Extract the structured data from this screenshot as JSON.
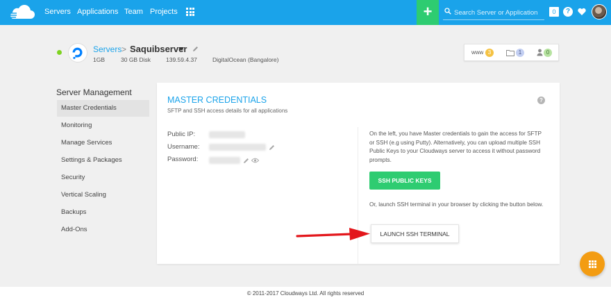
{
  "nav": {
    "items": [
      {
        "label": "Servers"
      },
      {
        "label": "Applications"
      },
      {
        "label": "Team"
      },
      {
        "label": "Projects"
      }
    ],
    "add_label": "+",
    "search_placeholder": "Search Server or Application",
    "notification_count": "0",
    "help_label": "?"
  },
  "server": {
    "breadcrumb_root": "Servers",
    "breadcrumb_sep": ">",
    "name": "Saquibserver",
    "ram": "1GB",
    "disk": "30 GB Disk",
    "ip": "139.59.4.37",
    "provider": "DigitalOcean (Bangalore)",
    "status_color": "#7ed321"
  },
  "stats": {
    "www_label": "www",
    "www_count": "3",
    "folders_count": "1",
    "users_count": "0"
  },
  "sidebar": {
    "title": "Server Management",
    "items": [
      {
        "label": "Master Credentials",
        "active": true
      },
      {
        "label": "Monitoring"
      },
      {
        "label": "Manage Services"
      },
      {
        "label": "Settings & Packages"
      },
      {
        "label": "Security"
      },
      {
        "label": "Vertical Scaling"
      },
      {
        "label": "Backups"
      },
      {
        "label": "Add-Ons"
      }
    ]
  },
  "panel": {
    "title": "MASTER CREDENTIALS",
    "subtitle": "SFTP and SSH access details for all applications",
    "help_label": "?",
    "fields": [
      {
        "label": "Public IP:"
      },
      {
        "label": "Username:"
      },
      {
        "label": "Password:"
      }
    ],
    "info_text": "On the left, you have Master credentials to gain the access for SFTP or SSH (e.g using Putty). Alternatively, you can upload multiple SSH Public Keys to your Cloudways server to access it without password prompts.",
    "ssh_keys_button": "SSH PUBLIC KEYS",
    "launch_text": "Or, launch SSH terminal in your browser by clicking the button below.",
    "launch_button": "LAUNCH SSH TERMINAL"
  },
  "footer": {
    "copyright": "© 2011-2017 Cloudways Ltd. All rights reserved"
  },
  "colors": {
    "brand_blue": "#1aa3ea",
    "green": "#2ecc71",
    "orange": "#f39c12",
    "arrow_red": "#e3161b"
  },
  "icons": [
    "cloud-logo-icon",
    "apps-grid-icon",
    "plus-icon",
    "search-icon",
    "help-icon",
    "heart-icon",
    "avatar",
    "digitalocean-icon",
    "caret-down-icon",
    "edit-icon",
    "folder-icon",
    "user-icon",
    "eye-icon",
    "red-arrow-icon",
    "fab-grid-icon"
  ]
}
